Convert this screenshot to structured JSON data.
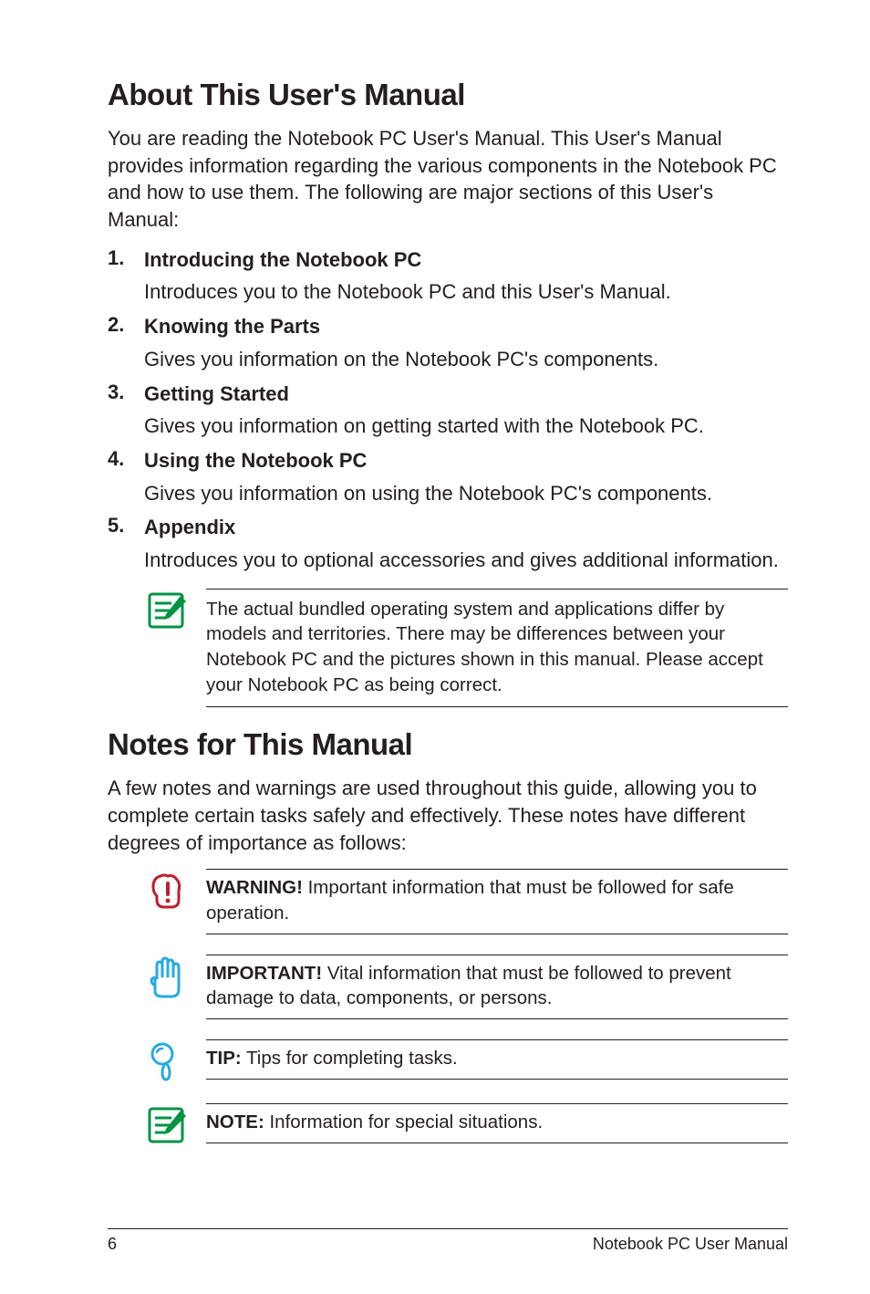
{
  "h1_about": "About This User's Manual",
  "intro_about": "You are reading the Notebook PC User's Manual. This User's Manual provides information regarding the various components in the Notebook PC and how to use them. The following are major sections of this User's Manual:",
  "sections": [
    {
      "title": "Introducing the Notebook PC",
      "desc": "Introduces you to the Notebook PC and this User's Manual."
    },
    {
      "title": "Knowing the Parts",
      "desc": "Gives you information on the Notebook PC's components."
    },
    {
      "title": "Getting Started",
      "desc": "Gives you information on getting started with the Notebook PC."
    },
    {
      "title": "Using the Notebook PC",
      "desc": "Gives you information on using the Notebook PC's components."
    },
    {
      "title": "Appendix",
      "desc": "Introduces you to optional accessories and gives additional information."
    }
  ],
  "note_bundled": "The actual bundled operating system and applications differ by models and territories. There may be differences between your Notebook PC and the pictures shown in this manual. Please accept your Notebook PC as being correct.",
  "h1_notes": "Notes for This Manual",
  "intro_notes": "A few notes and warnings are used throughout this guide, allowing you to complete certain tasks safely and effectively. These notes have different degrees of importance as follows:",
  "warning_label": "WARNING!",
  "warning_text": " Important information that must be followed for safe operation.",
  "important_label": "IMPORTANT!",
  "important_text": " Vital information that must be followed to prevent damage to data, components, or persons.",
  "tip_label": "TIP:",
  "tip_text": " Tips for completing tasks.",
  "note_label": "NOTE:",
  "note_text": "  Information for special situations.",
  "footer_page": "6",
  "footer_title": "Notebook PC User Manual",
  "colors": {
    "green": "#009444",
    "red": "#be1e2d",
    "blue": "#27aae1"
  }
}
